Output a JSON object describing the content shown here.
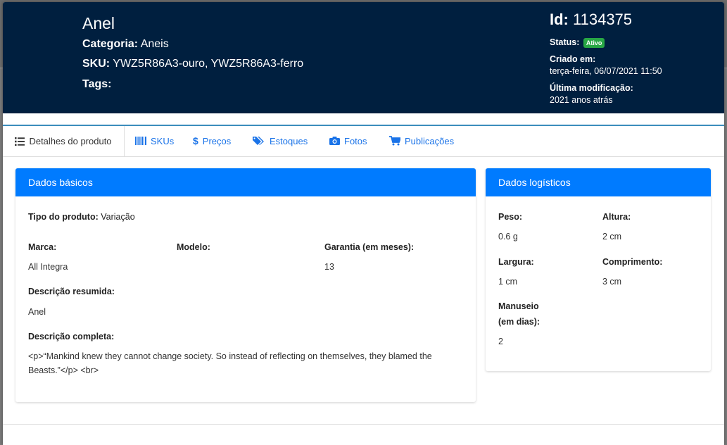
{
  "header": {
    "product_name": "Anel",
    "categoria_label": "Categoria:",
    "categoria_value": "Aneis",
    "sku_label": "SKU:",
    "sku_value": "YWZ5R86A3-ouro, YWZ5R86A3-ferro",
    "tags_label": "Tags:",
    "id_label": "Id:",
    "id_value": "1134375",
    "status_label": "Status:",
    "status_value": "Ativo",
    "criado_label": "Criado em:",
    "criado_value": "terça-feira, 06/07/2021 11:50",
    "modificacao_label": "Última modificação:",
    "modificacao_value": "2021 anos atrás"
  },
  "tabs": [
    {
      "label": "Detalhes do produto",
      "icon": "list-icon",
      "active": true
    },
    {
      "label": "SKUs",
      "icon": "barcode-icon"
    },
    {
      "label": "Preços",
      "icon": "dollar-icon"
    },
    {
      "label": "Estoques",
      "icon": "tags-icon"
    },
    {
      "label": "Fotos",
      "icon": "camera-icon"
    },
    {
      "label": "Publicações",
      "icon": "cart-icon"
    }
  ],
  "basic": {
    "title": "Dados básicos",
    "tipo_label": "Tipo do produto:",
    "tipo_value": "Variação",
    "marca_label": "Marca:",
    "marca_value": "All Integra",
    "modelo_label": "Modelo:",
    "modelo_value": "",
    "garantia_label": "Garantia (em meses):",
    "garantia_value": "13",
    "desc_resumida_label": "Descrição resumida:",
    "desc_resumida_value": "Anel",
    "desc_completa_label": "Descrição completa:",
    "desc_completa_value": "<p>“Mankind knew they cannot change society. So instead of reflecting on themselves, they blamed the Beasts.”</p> <br>"
  },
  "logistics": {
    "title": "Dados logísticos",
    "peso_label": "Peso:",
    "peso_value": "0.6 g",
    "altura_label": "Altura:",
    "altura_value": "2 cm",
    "largura_label": "Largura:",
    "largura_value": "1 cm",
    "comprimento_label": "Comprimento:",
    "comprimento_value": "3 cm",
    "manuseio_label_1": "Manuseio",
    "manuseio_label_2": "(em dias):",
    "manuseio_value": "2"
  },
  "colors": {
    "header_bg": "#001f3f",
    "card_header_bg": "#007bff",
    "link": "#1a73e8",
    "badge_active": "#28a745"
  }
}
